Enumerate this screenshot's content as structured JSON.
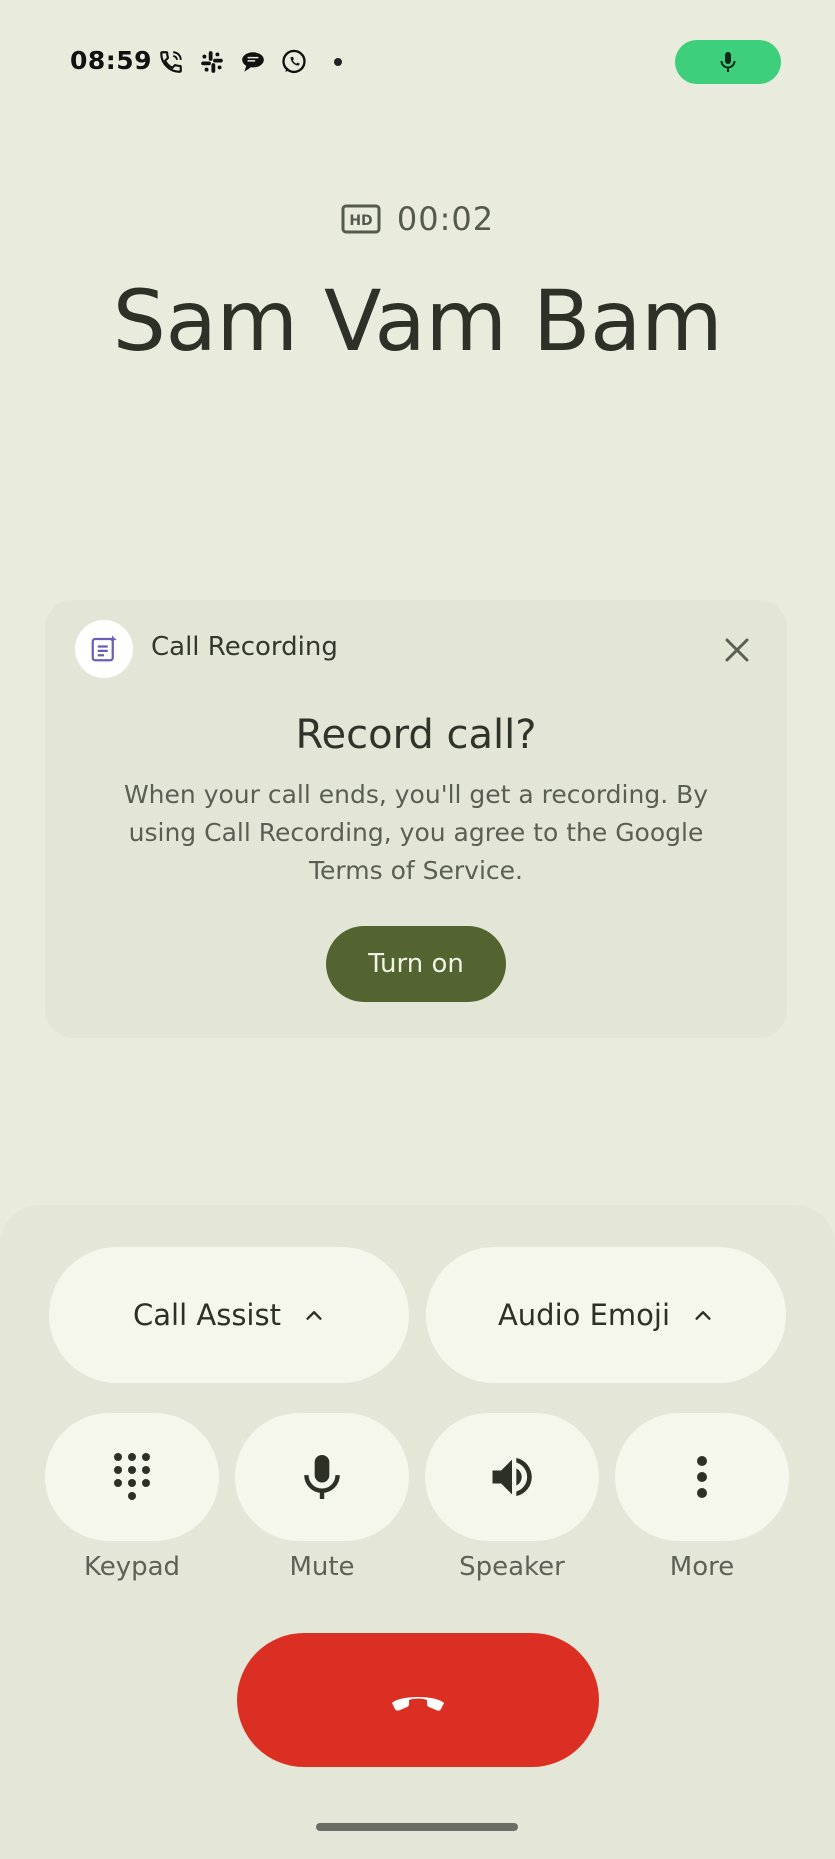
{
  "status_bar": {
    "time": "08:59",
    "icons": [
      "wifi-calling-icon",
      "slack-icon",
      "chat-bubble-icon",
      "whatsapp-icon",
      "more-notifications-dot"
    ],
    "mic_indicator": "mic-icon",
    "mic_indicator_color": "#3ecf7c"
  },
  "call": {
    "hd_badge": "HD",
    "timer": "00:02",
    "caller_name": "Sam Vam Bam"
  },
  "recording_card": {
    "label": "Call Recording",
    "title": "Record call?",
    "description": "When your call ends, you'll get a recording. By using Call Recording, you agree to the Google Terms of Service.",
    "button": "Turn on",
    "button_color": "#546430"
  },
  "actions": {
    "call_assist": "Call Assist",
    "audio_emoji": "Audio Emoji",
    "keypad": "Keypad",
    "mute": "Mute",
    "speaker": "Speaker",
    "more": "More"
  },
  "end_call_color": "#dc2f24"
}
